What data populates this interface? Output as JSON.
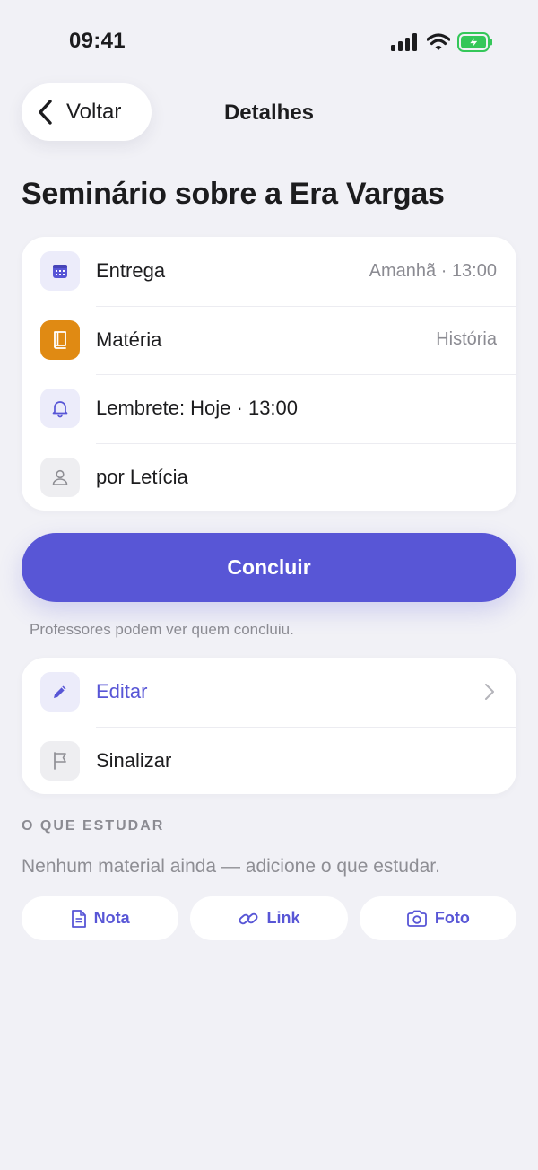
{
  "status_bar": {
    "time": "09:41"
  },
  "nav": {
    "back_label": "Voltar",
    "title": "Detalhes"
  },
  "page": {
    "title": "Seminário sobre a Era Vargas"
  },
  "details": [
    {
      "label": "Entrega",
      "value": "Amanhã · 13:00",
      "icon": "calendar-icon"
    },
    {
      "label": "Matéria",
      "value": "História",
      "icon": "book-icon"
    },
    {
      "label": "Lembrete: Hoje · 13:00",
      "icon": "bell-icon"
    },
    {
      "label": "por Letícia",
      "icon": "person-icon"
    }
  ],
  "conclude": {
    "label": "Concluir",
    "note": "Professores podem ver quem concluiu."
  },
  "actions": [
    {
      "label": "Editar",
      "icon": "pencil-icon"
    },
    {
      "label": "Sinalizar",
      "icon": "flag-icon"
    }
  ],
  "study": {
    "header": "O QUE ESTUDAR",
    "empty": "Nenhum material ainda — adicione o que estudar.",
    "buttons": [
      {
        "label": "Nota",
        "icon": "document-icon"
      },
      {
        "label": "Link",
        "icon": "link-icon"
      },
      {
        "label": "Foto",
        "icon": "camera-icon"
      }
    ]
  },
  "colors": {
    "accent": "#5856d6",
    "subject": "#e08a13",
    "background": "#f1f1f6",
    "battery": "#34c759"
  }
}
